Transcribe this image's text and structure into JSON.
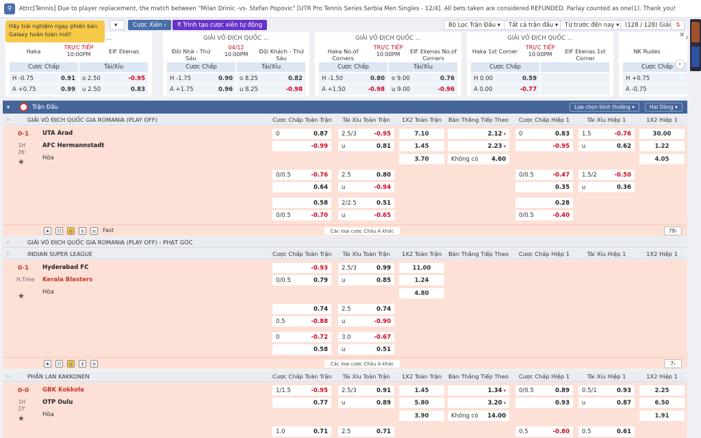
{
  "notice": {
    "text": "Attrc[Tennis] Due to player replacement, the match between \"Milan Drinic -vs- Stefan Popovic\" [UTR Pro Tennis Series Serbia Men Singles - 12/4]. All bets taken are considered REFUNDED. Parlay counted as one(1). Thank you!"
  },
  "toolbar": {
    "cuoc_xien": "Cược Xiên",
    "tao_xien": "Trình tạo cược xiên tự động",
    "loc": "Bộ Lọc Trận Đấu",
    "all": "Tất cả trận đấu",
    "time": "Từ trước đến nay",
    "count": "(128 / 128) Giải"
  },
  "promo": {
    "text": "Hãy trải nghiệm ngay phiên bản Galaxy hoàn toàn mới!"
  },
  "cards": [
    {
      "title": "GIẢI VÔ ĐỊCH QUỐC ...",
      "home": "Haka",
      "away": "EIF Ekenas",
      "status": "TRỰC TIẾP",
      "time": "10:00PM",
      "hd1": "Cược Chấp",
      "hd2": "Tài/Xỉu",
      "rows": [
        [
          "H -0.75",
          "0.91",
          "o 2.50",
          "-0.95"
        ],
        [
          "A +0.75",
          "0.99",
          "u 2.50",
          "0.83"
        ]
      ]
    },
    {
      "title": "GIẢI VÔ ĐỊCH QUỐC ...",
      "home": "Đội Nhà - Thứ Sáu",
      "away": "Đội Khách - Thứ Sáu",
      "status": "04/12",
      "time": "10:00PM",
      "hd1": "Cược Chấp",
      "hd2": "Tài/Xỉu",
      "rows": [
        [
          "H -1.75",
          "0.90",
          "o 8.25",
          "0.82"
        ],
        [
          "A +1.75",
          "0.96",
          "u 8.25",
          "-0.98"
        ]
      ]
    },
    {
      "title": "GIẢI VÔ ĐỊCH QUỐC ...",
      "home": "Haka No.of Corners",
      "away": "EIF Ekenas No.of Corners",
      "status": "TRỰC TIẾP",
      "time": "10:00PM",
      "hd1": "Cược Chấp",
      "hd2": "Tài/Xỉu",
      "rows": [
        [
          "H -1.50",
          "0.80",
          "o 9.00",
          "0.76"
        ],
        [
          "A +1.50",
          "-0.98",
          "u 9.00",
          "-0.96"
        ]
      ]
    },
    {
      "title": "GIẢI VÔ ĐỊCH QUỐC ...",
      "home": "Haka 1st Corner",
      "away": "EIF Ekenas 1st Corner",
      "status": "TRỰC TIẾP",
      "time": "10:00PM",
      "hd1": "Cược Chấp",
      "hd2": "",
      "rows": [
        [
          "H 0.00",
          "0.59",
          "",
          ""
        ],
        [
          "A 0.00",
          "-0.77",
          "",
          ""
        ]
      ]
    },
    {
      "title": "GIẢI",
      "home": "NK Rudes",
      "away": "",
      "status": "",
      "time": "",
      "hd1": "Cược Chấp",
      "hd2": "",
      "rows": [
        [
          "H +0.75",
          "",
          "",
          ""
        ],
        [
          "A -0.75",
          "",
          "",
          ""
        ]
      ]
    }
  ],
  "main": {
    "title": "Trận Đấu",
    "sort": "Lựa chọn bình thường",
    "lines": "Hai Dòng"
  },
  "columns": [
    "Cược Chấp Toàn Trận",
    "Tài Xỉu Toàn Trận",
    "1X2 Toàn Trận",
    "Bàn Thắng Tiếp Theo",
    "Cược Chấp Hiệp 1",
    "Tài Xỉu Hiệp 1",
    "1X2 Hiệp 1"
  ],
  "leagues": [
    {
      "name": "GIẢI VÔ ĐỊCH QUỐC GIA ROMANIA (PLAY OFF)"
    },
    {
      "name": "GIẢI VÔ ĐỊCH QUỐC GIA ROMANIA (PLAY OFF) - PHẠT GÓC"
    },
    {
      "name": "INDIAN SUPER LEAGUE"
    },
    {
      "name": "PHẦN LAN KAKKONEN"
    }
  ],
  "m1": {
    "score": "0-1",
    "t1": "1H",
    "t2": "26'",
    "home": "UTA Arad",
    "away": "AFC Hermannstadt",
    "draw": "Hòa",
    "fast": "Fast",
    "more": "Các loại cược Châu Á khác",
    "count": "78",
    "r1": [
      "0",
      "0.87",
      "2.5/3",
      "-0.95",
      "7.10",
      "2.12",
      "0",
      "0.83",
      "1.5",
      "-0.76",
      "30.00"
    ],
    "r2": [
      "",
      "-0.99",
      "u",
      "0.81",
      "1.45",
      "2.23",
      "",
      "-0.95",
      "u",
      "0.62",
      "1.22"
    ],
    "r3": [
      "3.70",
      "Không có",
      "4.60",
      "4.05"
    ],
    "r4": [
      "0/0.5",
      "-0.76",
      "2.5",
      "0.80",
      "0/0.5",
      "-0.47",
      "1.5/2",
      "-0.50"
    ],
    "r5": [
      "",
      "0.64",
      "u",
      "-0.94",
      "",
      "0.35",
      "u",
      "0.36"
    ],
    "r6": [
      "",
      "0.58",
      "2/2.5",
      "0.51",
      "",
      "0.28"
    ],
    "r7": [
      "0/0.5",
      "-0.70",
      "u",
      "-0.65",
      "0/0.5",
      "-0.40"
    ]
  },
  "m2": {
    "score": "0-1",
    "t1": "H.Time",
    "home": "Hyderabad FC",
    "away": "Kerala Blasters",
    "draw": "Hòa",
    "more": "Các loại cược Châu Á khác",
    "count": "7",
    "r1": [
      "",
      "-0.93",
      "2.5/3",
      "0.99",
      "11.00"
    ],
    "r2": [
      "0/0.5",
      "0.79",
      "u",
      "0.85",
      "1.24"
    ],
    "r3": [
      "4.80"
    ],
    "r4": [
      "",
      "0.74",
      "2.5",
      "0.74"
    ],
    "r5": [
      "0.5",
      "-0.88",
      "u",
      "-0.90"
    ],
    "r6": [
      "0",
      "-0.72",
      "3.0",
      "-0.67"
    ],
    "r7": [
      "",
      "0.58",
      "u",
      "0.51"
    ]
  },
  "m3": {
    "score": "0-0",
    "t1": "1H",
    "t2": "27'",
    "home": "GBK Kokkola",
    "away": "OTP Oulu",
    "draw": "Hòa",
    "r1": [
      "1/1.5",
      "-0.95",
      "2.5/3",
      "0.91",
      "1.45",
      "1.34",
      "0/0.5",
      "0.89",
      "0.5/1",
      "0.93",
      "2.25"
    ],
    "r2": [
      "",
      "0.77",
      "u",
      "0.89",
      "5.80",
      "3.20",
      "",
      "0.93",
      "u",
      "0.87",
      "6.50"
    ],
    "r3": [
      "3.90",
      "Không có",
      "14.00",
      "1.91"
    ],
    "r4": [
      "1.0",
      "0.71",
      "2.5",
      "0.71",
      "0.5",
      "-0.80",
      "0.5",
      "0.61"
    ]
  }
}
